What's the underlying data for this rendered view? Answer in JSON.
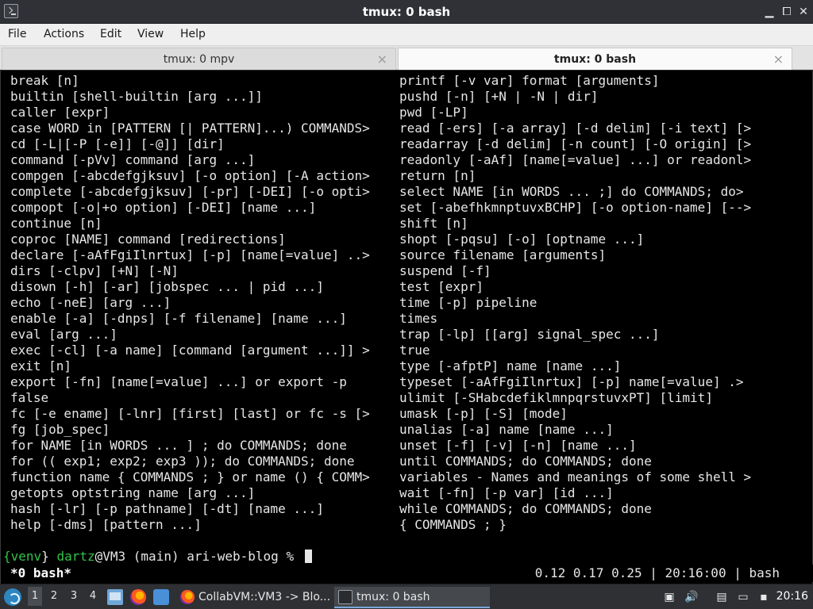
{
  "window": {
    "title": "tmux: 0 bash",
    "controls": {
      "minimize": "▁",
      "maximize": "⧠",
      "close": "✕"
    }
  },
  "menu": [
    "File",
    "Actions",
    "Edit",
    "View",
    "Help"
  ],
  "tabs": [
    {
      "label": "tmux: 0 mpv",
      "active": false,
      "close": "×"
    },
    {
      "label": "tmux: 0 bash",
      "active": true,
      "close": "×"
    }
  ],
  "terminal": {
    "left_lines": [
      "break [n]",
      "builtin [shell-builtin [arg ...]]",
      "caller [expr]",
      "case WORD in [PATTERN [| PATTERN]...) COMMANDS>",
      "cd [-L|[-P [-e]] [-@]] [dir]",
      "command [-pVv] command [arg ...]",
      "compgen [-abcdefgjksuv] [-o option] [-A action>",
      "complete [-abcdefgjksuv] [-pr] [-DEI] [-o opti>",
      "compopt [-o|+o option] [-DEI] [name ...]",
      "continue [n]",
      "coproc [NAME] command [redirections]",
      "declare [-aAfFgiIlnrtux] [-p] [name[=value] ..>",
      "dirs [-clpv] [+N] [-N]",
      "disown [-h] [-ar] [jobspec ... | pid ...]",
      "echo [-neE] [arg ...]",
      "enable [-a] [-dnps] [-f filename] [name ...]",
      "eval [arg ...]",
      "exec [-cl] [-a name] [command [argument ...]] >",
      "exit [n]",
      "export [-fn] [name[=value] ...] or export -p",
      "false",
      "fc [-e ename] [-lnr] [first] [last] or fc -s [>",
      "fg [job_spec]",
      "for NAME [in WORDS ... ] ; do COMMANDS; done",
      "for (( exp1; exp2; exp3 )); do COMMANDS; done",
      "function name { COMMANDS ; } or name () { COMM>",
      "getopts optstring name [arg ...]",
      "hash [-lr] [-p pathname] [-dt] [name ...]",
      "help [-dms] [pattern ...]"
    ],
    "right_lines": [
      "printf [-v var] format [arguments]",
      "pushd [-n] [+N | -N | dir]",
      "pwd [-LP]",
      "read [-ers] [-a array] [-d delim] [-i text] [>",
      "readarray [-d delim] [-n count] [-O origin] [>",
      "readonly [-aAf] [name[=value] ...] or readonl>",
      "return [n]",
      "select NAME [in WORDS ... ;] do COMMANDS; do>",
      "set [-abefhkmnptuvxBCHP] [-o option-name] [-->",
      "shift [n]",
      "shopt [-pqsu] [-o] [optname ...]",
      "source filename [arguments]",
      "suspend [-f]",
      "test [expr]",
      "time [-p] pipeline",
      "times",
      "trap [-lp] [[arg] signal_spec ...]",
      "true",
      "type [-afptP] name [name ...]",
      "typeset [-aAfFgiIlnrtux] [-p] name[=value] .>",
      "ulimit [-SHabcdefiklmnpqrstuvxPT] [limit]",
      "umask [-p] [-S] [mode]",
      "unalias [-a] name [name ...]",
      "unset [-f] [-v] [-n] [name ...]",
      "until COMMANDS; do COMMANDS; done",
      "variables - Names and meanings of some shell >",
      "wait [-fn] [-p var] [id ...]",
      "while COMMANDS; do COMMANDS; done",
      "{ COMMANDS ; }"
    ],
    "prompt": {
      "open": "{",
      "venv": "venv",
      "close": "}",
      "user": "dartz",
      "rest": "@VM3 (main) ari-web-blog % "
    },
    "status": {
      "left": "*0 bash*",
      "right": "0.12 0.17 0.25 | 20:16:00 | bash"
    }
  },
  "taskbar": {
    "workspaces": [
      "1",
      "2",
      "3",
      "4"
    ],
    "active_workspace": "1",
    "tasks": [
      {
        "label": "CollabVM::VM3 -> Blo...",
        "icon": "firefox-icon",
        "active": false
      },
      {
        "label": "tmux: 0 bash",
        "icon": "terminal-icon",
        "active": true
      }
    ],
    "clock": "20:16"
  }
}
